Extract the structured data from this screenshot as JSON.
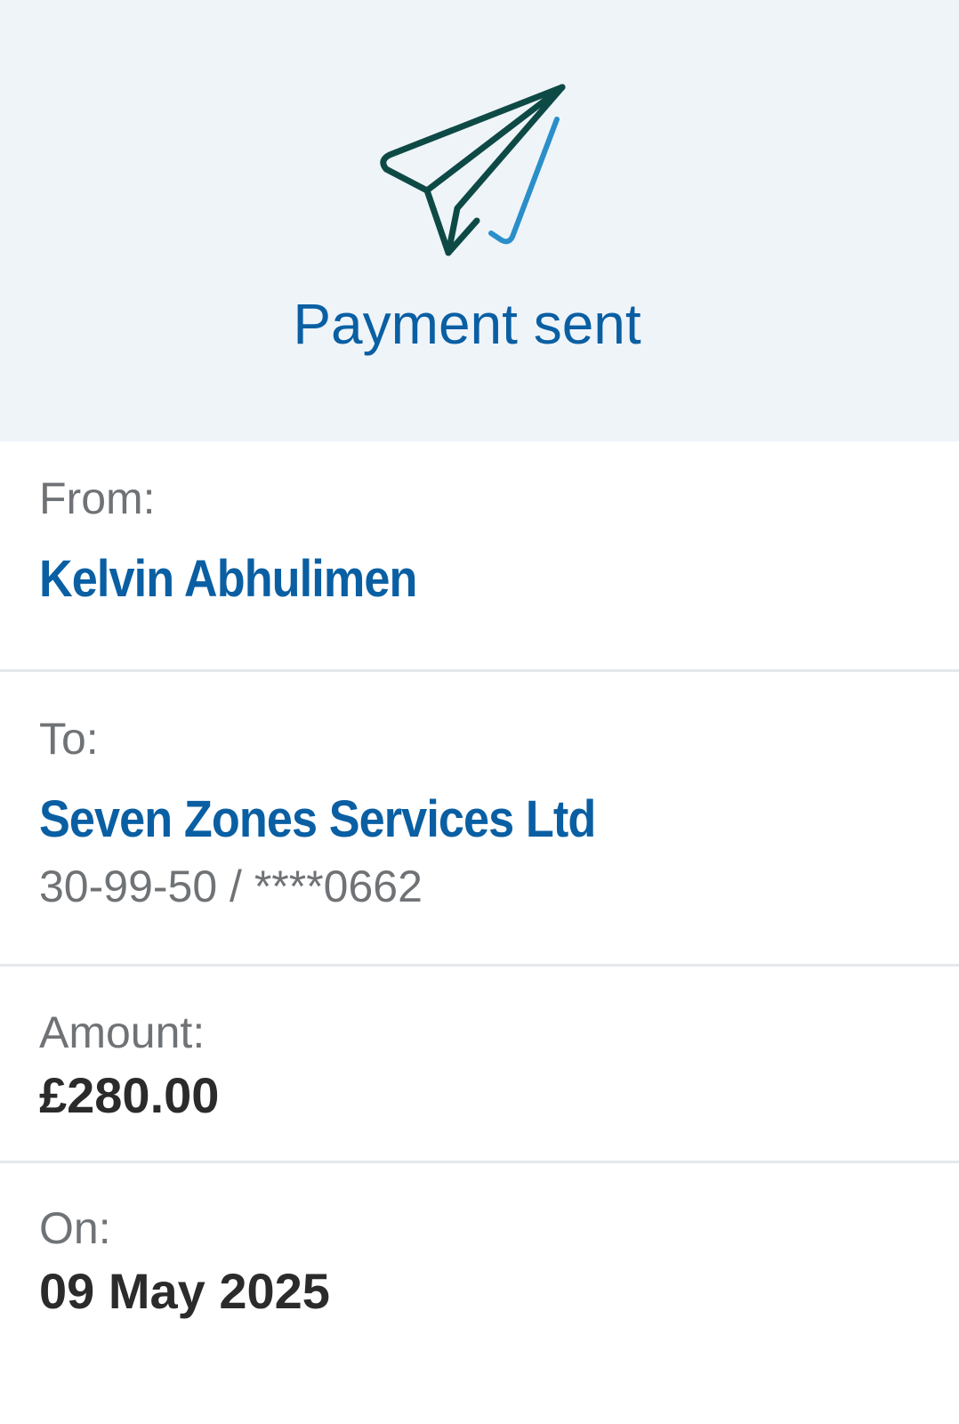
{
  "header": {
    "icon": "paper-plane-icon",
    "title": "Payment sent",
    "colors": {
      "background": "#eff4f9",
      "title": "#0a5fa3",
      "plane_dark": "#0e4a45",
      "plane_light": "#2a8fc9"
    }
  },
  "from": {
    "label": "From:",
    "name": "Kelvin Abhulimen"
  },
  "to": {
    "label": "To:",
    "name": "Seven Zones Services Ltd",
    "account": "30-99-50 / ****0662"
  },
  "amount": {
    "label": "Amount:",
    "value": "£280.00"
  },
  "date": {
    "label": "On:",
    "value": "09 May 2025"
  },
  "colors": {
    "accent": "#0a5fa3",
    "label": "#707376",
    "value": "#2b2b2b",
    "divider": "#e4e8ec"
  }
}
